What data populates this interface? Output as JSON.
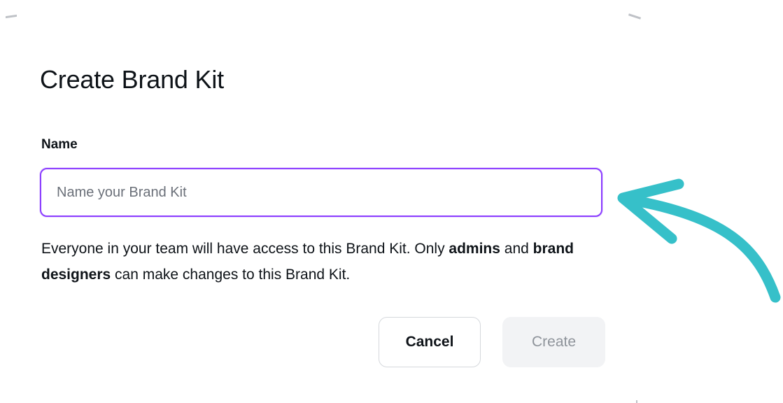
{
  "dialog": {
    "title": "Create Brand Kit",
    "name_label": "Name",
    "name_input": {
      "value": "",
      "placeholder": "Name your Brand Kit"
    },
    "help_text": {
      "part1": "Everyone in your team will have access to this Brand Kit. Only ",
      "bold1": "admins",
      "part2": " and ",
      "bold2": "brand designers",
      "part3": " can make changes to this Brand Kit."
    },
    "buttons": {
      "cancel_label": "Cancel",
      "create_label": "Create"
    }
  },
  "annotation": {
    "icon": "curved-arrow-icon",
    "color": "#36c0c9"
  },
  "colors": {
    "input_focus_border": "#8b3dff",
    "text_primary": "#0e1318",
    "create_disabled_bg": "#f2f3f5",
    "create_disabled_text": "#8e939a"
  }
}
